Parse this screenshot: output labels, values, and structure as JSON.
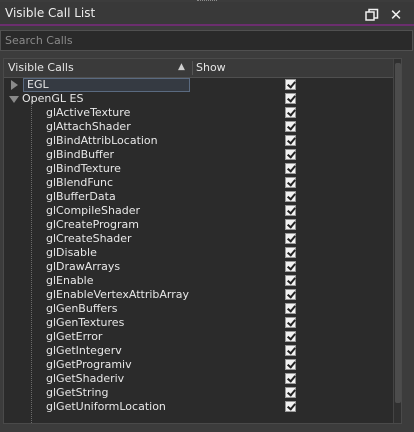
{
  "window": {
    "title": "Visible Call List",
    "float_icon": "float-window-icon",
    "close_icon": "close-icon"
  },
  "search": {
    "placeholder": "Search Calls",
    "value": ""
  },
  "table": {
    "columns": {
      "calls": "Visible Calls",
      "show": "Show"
    },
    "groups": [
      {
        "label": "EGL",
        "expanded": false,
        "checked": true
      },
      {
        "label": "OpenGL ES",
        "expanded": true,
        "checked": true
      }
    ],
    "calls": [
      "glActiveTexture",
      "glAttachShader",
      "glBindAttribLocation",
      "glBindBuffer",
      "glBindTexture",
      "glBlendFunc",
      "glBufferData",
      "glCompileShader",
      "glCreateProgram",
      "glCreateShader",
      "glDisable",
      "glDrawArrays",
      "glEnable",
      "glEnableVertexAttribArray",
      "glGenBuffers",
      "glGenTextures",
      "glGetError",
      "glGetIntegerv",
      "glGetProgramiv",
      "glGetShaderiv",
      "glGetString",
      "glGetUniformLocation"
    ]
  },
  "colors": {
    "accent": "#6b2e6e",
    "background": "#3c3c3c",
    "panel": "#2b2b2b"
  }
}
